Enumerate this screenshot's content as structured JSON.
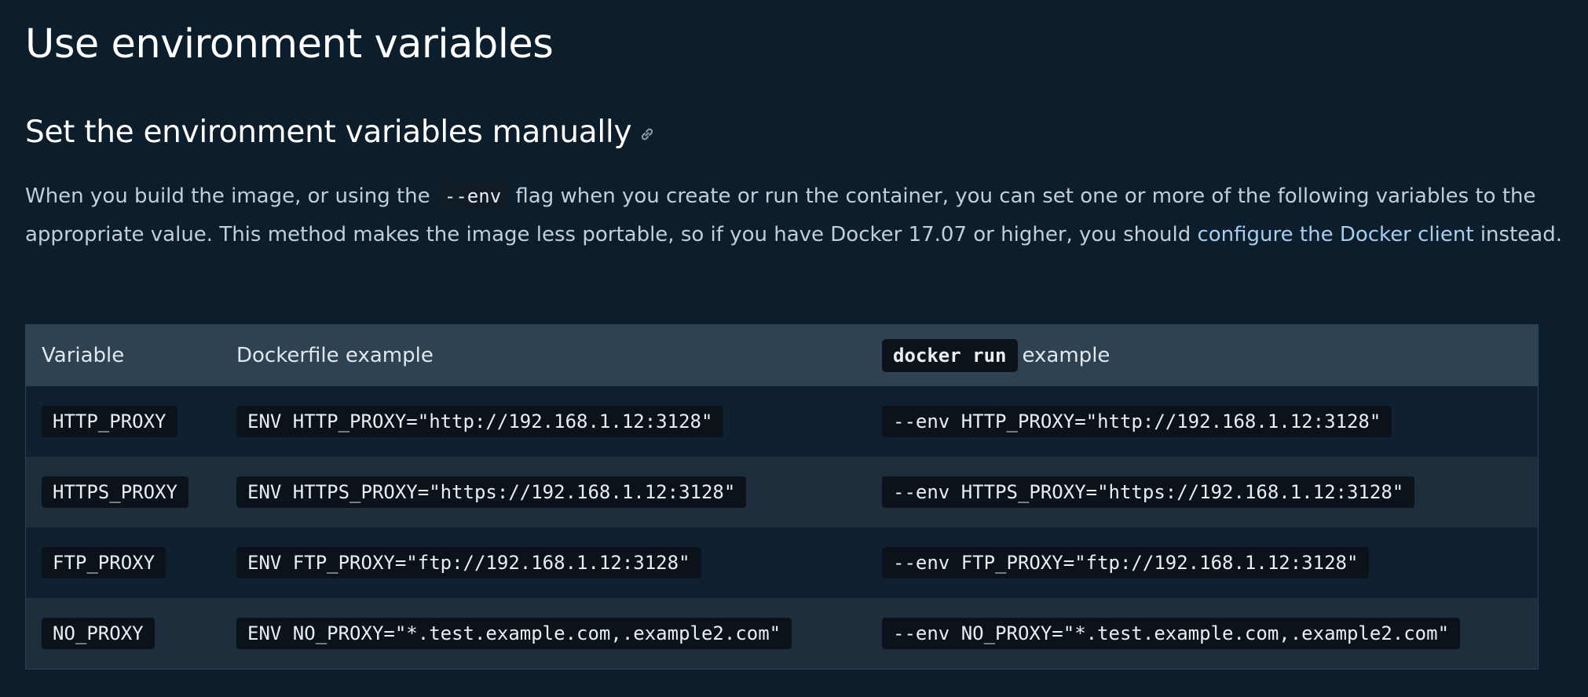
{
  "page": {
    "title": "Use environment variables",
    "section_heading": "Set the environment variables manually",
    "anchor_icon": "link-icon"
  },
  "paragraph": {
    "text_1": "When you build the image, or using the ",
    "code_1": "--env",
    "text_2": " flag when you create or run the container, you can set one or more of the following variables to the appropriate value. This method makes the image less portable, so if you have Docker 17.07 or higher, you should ",
    "link_text": "configure the Docker client",
    "text_3": " instead."
  },
  "table": {
    "headers": {
      "variable": "Variable",
      "dockerfile": "Dockerfile example",
      "run_code": "docker run",
      "run_suffix": "example"
    },
    "rows": [
      {
        "variable": "HTTP_PROXY",
        "dockerfile": "ENV HTTP_PROXY=\"http://192.168.1.12:3128\"",
        "run": "--env HTTP_PROXY=\"http://192.168.1.12:3128\""
      },
      {
        "variable": "HTTPS_PROXY",
        "dockerfile": "ENV HTTPS_PROXY=\"https://192.168.1.12:3128\"",
        "run": "--env HTTPS_PROXY=\"https://192.168.1.12:3128\""
      },
      {
        "variable": "FTP_PROXY",
        "dockerfile": "ENV FTP_PROXY=\"ftp://192.168.1.12:3128\"",
        "run": "--env FTP_PROXY=\"ftp://192.168.1.12:3128\""
      },
      {
        "variable": "NO_PROXY",
        "dockerfile": "ENV NO_PROXY=\"*.test.example.com,.example2.com\"",
        "run": "--env NO_PROXY=\"*.test.example.com,.example2.com\""
      }
    ]
  },
  "colors": {
    "background": "#0c1d2c",
    "link": "#a8cdee",
    "header_row": "#2f4252",
    "code_bg": "#0b1219"
  }
}
